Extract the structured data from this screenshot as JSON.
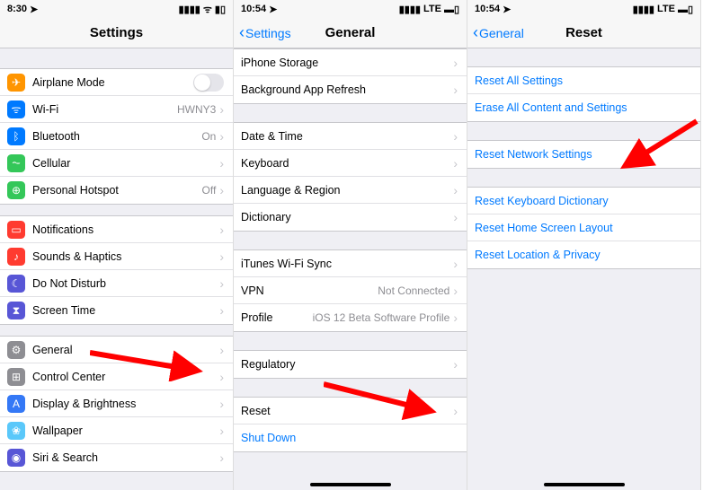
{
  "screen1": {
    "time": "8:30",
    "title": "Settings",
    "g1": [
      {
        "label": "Airplane Mode",
        "icon": "✈",
        "bg": "bg-orange",
        "toggle": true
      },
      {
        "label": "Wi-Fi",
        "value": "HWNY3",
        "icon": "ᯤ",
        "bg": "bg-blue"
      },
      {
        "label": "Bluetooth",
        "value": "On",
        "icon": "ᛒ",
        "bg": "bg-blue"
      },
      {
        "label": "Cellular",
        "icon": "⏦",
        "bg": "bg-green"
      },
      {
        "label": "Personal Hotspot",
        "value": "Off",
        "icon": "⊕",
        "bg": "bg-green"
      }
    ],
    "g2": [
      {
        "label": "Notifications",
        "icon": "▭",
        "bg": "bg-red"
      },
      {
        "label": "Sounds & Haptics",
        "icon": "♪",
        "bg": "bg-red"
      },
      {
        "label": "Do Not Disturb",
        "icon": "☾",
        "bg": "bg-purple"
      },
      {
        "label": "Screen Time",
        "icon": "⧗",
        "bg": "bg-purple"
      }
    ],
    "g3": [
      {
        "label": "General",
        "icon": "⚙",
        "bg": "bg-grey"
      },
      {
        "label": "Control Center",
        "icon": "⊞",
        "bg": "bg-grey"
      },
      {
        "label": "Display & Brightness",
        "icon": "A",
        "bg": "bg-dblue"
      },
      {
        "label": "Wallpaper",
        "icon": "❀",
        "bg": "bg-teal"
      },
      {
        "label": "Siri & Search",
        "icon": "◉",
        "bg": "bg-purple"
      }
    ]
  },
  "screen2": {
    "time": "10:54",
    "back": "Settings",
    "title": "General",
    "net": "LTE",
    "g1": [
      {
        "label": "iPhone Storage"
      },
      {
        "label": "Background App Refresh"
      }
    ],
    "g2": [
      {
        "label": "Date & Time"
      },
      {
        "label": "Keyboard"
      },
      {
        "label": "Language & Region"
      },
      {
        "label": "Dictionary"
      }
    ],
    "g3": [
      {
        "label": "iTunes Wi-Fi Sync"
      },
      {
        "label": "VPN",
        "value": "Not Connected"
      },
      {
        "label": "Profile",
        "value": "iOS 12 Beta Software Profile"
      }
    ],
    "g4": [
      {
        "label": "Regulatory"
      }
    ],
    "g5": [
      {
        "label": "Reset"
      },
      {
        "label": "Shut Down",
        "blue": true,
        "nochev": true
      }
    ]
  },
  "screen3": {
    "time": "10:54",
    "back": "General",
    "title": "Reset",
    "net": "LTE",
    "g1": [
      {
        "label": "Reset All Settings"
      },
      {
        "label": "Erase All Content and Settings"
      }
    ],
    "g2": [
      {
        "label": "Reset Network Settings"
      }
    ],
    "g3": [
      {
        "label": "Reset Keyboard Dictionary"
      },
      {
        "label": "Reset Home Screen Layout"
      },
      {
        "label": "Reset Location & Privacy"
      }
    ]
  }
}
